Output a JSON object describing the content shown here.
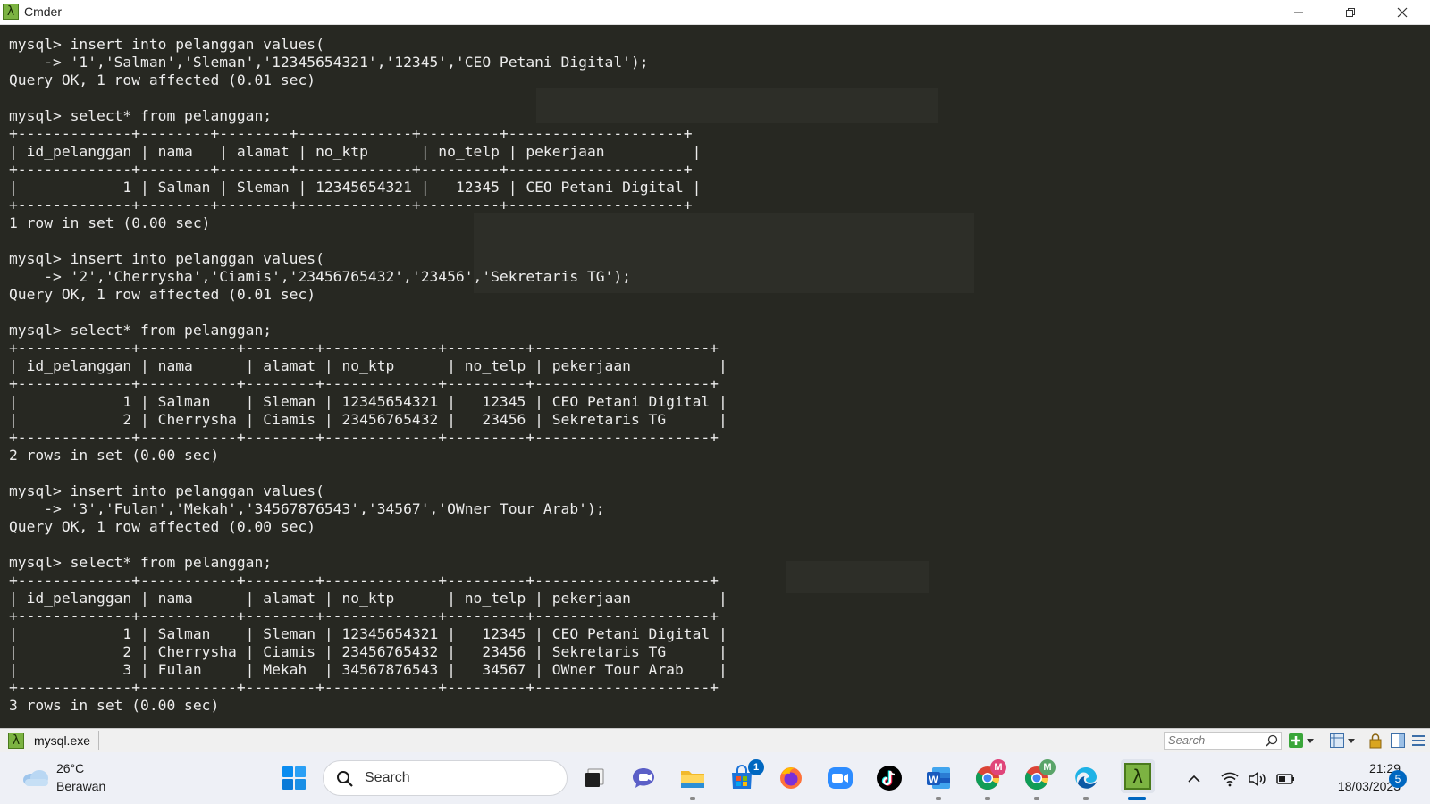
{
  "window": {
    "title": "Cmder"
  },
  "terminal": {
    "lines": [
      "mysql> insert into pelanggan values(",
      "    -> '1','Salman','Sleman','12345654321','12345','CEO Petani Digital');",
      "Query OK, 1 row affected (0.01 sec)",
      "",
      "mysql> select* from pelanggan;",
      "+-------------+--------+--------+-------------+---------+--------------------+",
      "| id_pelanggan | nama   | alamat | no_ktp      | no_telp | pekerjaan          |",
      "+-------------+--------+--------+-------------+---------+--------------------+",
      "|            1 | Salman | Sleman | 12345654321 |   12345 | CEO Petani Digital |",
      "+-------------+--------+--------+-------------+---------+--------------------+",
      "1 row in set (0.00 sec)",
      "",
      "mysql> insert into pelanggan values(",
      "    -> '2','Cherrysha','Ciamis','23456765432','23456','Sekretaris TG');",
      "Query OK, 1 row affected (0.01 sec)",
      "",
      "mysql> select* from pelanggan;",
      "+-------------+-----------+--------+-------------+---------+--------------------+",
      "| id_pelanggan | nama      | alamat | no_ktp      | no_telp | pekerjaan          |",
      "+-------------+-----------+--------+-------------+---------+--------------------+",
      "|            1 | Salman    | Sleman | 12345654321 |   12345 | CEO Petani Digital |",
      "|            2 | Cherrysha | Ciamis | 23456765432 |   23456 | Sekretaris TG      |",
      "+-------------+-----------+--------+-------------+---------+--------------------+",
      "2 rows in set (0.00 sec)",
      "",
      "mysql> insert into pelanggan values(",
      "    -> '3','Fulan','Mekah','34567876543','34567','OWner Tour Arab');",
      "Query OK, 1 row affected (0.00 sec)",
      "",
      "mysql> select* from pelanggan;",
      "+-------------+-----------+--------+-------------+---------+--------------------+",
      "| id_pelanggan | nama      | alamat | no_ktp      | no_telp | pekerjaan          |",
      "+-------------+-----------+--------+-------------+---------+--------------------+",
      "|            1 | Salman    | Sleman | 12345654321 |   12345 | CEO Petani Digital |",
      "|            2 | Cherrysha | Ciamis | 23456765432 |   23456 | Sekretaris TG      |",
      "|            3 | Fulan     | Mekah  | 34567876543 |   34567 | OWner Tour Arab    |",
      "+-------------+-----------+--------+-------------+---------+--------------------+",
      "3 rows in set (0.00 sec)"
    ]
  },
  "tabbar": {
    "tab_label": "mysql.exe",
    "search_placeholder": "Search"
  },
  "taskbar": {
    "weather_temp": "26°C",
    "weather_desc": "Berawan",
    "search_label": "Search",
    "store_badge": "1",
    "chrome_profile_1": "M",
    "chrome_profile_2": "M",
    "clock_time": "21:29",
    "clock_date": "18/03/2023",
    "notification_count": "5"
  },
  "colors": {
    "terminal_bg": "#272822",
    "terminal_fg": "#ececec",
    "cmder_green": "#7cb342",
    "taskbar_bg": "#eef0f6",
    "accent": "#0067c0"
  }
}
